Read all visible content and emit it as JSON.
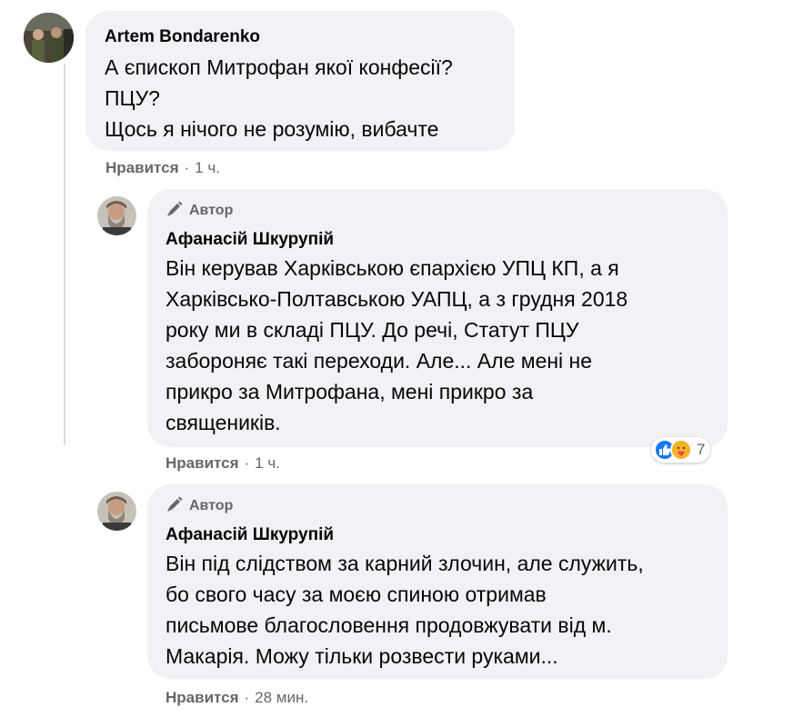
{
  "comments": [
    {
      "author": "Artem Bondarenko",
      "lines": [
        "А єпископ Митрофан якої конфесії?",
        "ПЦУ?",
        "Щось я нічого не розумію, вибачте"
      ],
      "like_label": "Нравится",
      "time": "1 ч."
    },
    {
      "badge": "Автор",
      "author": "Афанасій Шкурупій",
      "lines": [
        "Він керував Харківською єпархією УПЦ КП, а я",
        "Харківсько-Полтавською УАПЦ, а з грудня 2018",
        "року ми в складі ПЦУ. До речі, Статут ПЦУ",
        "забороняє такі переходи. Але... Але мені не",
        "прикро за Митрофана, мені прикро за",
        "священиків."
      ],
      "like_label": "Нравится",
      "time": "1 ч.",
      "reaction_count": "7"
    },
    {
      "badge": "Автор",
      "author": "Афанасій Шкурупій",
      "lines": [
        "Він під слідством за карний злочин, але служить,",
        "бо свого часу за моєю спиною отримав",
        "письмове благословення продовжувати від м.",
        "Макарія. Можу тільки розвести руками..."
      ],
      "like_label": "Нравится",
      "time": "28 мин."
    }
  ],
  "colors": {
    "bubble": "#f0f2f5",
    "meta": "#65676b",
    "like_reaction": "#1877f2",
    "care_reaction": "#f7b125"
  },
  "icons": [
    "author-pen-icon",
    "like-reaction-icon",
    "care-reaction-icon"
  ]
}
